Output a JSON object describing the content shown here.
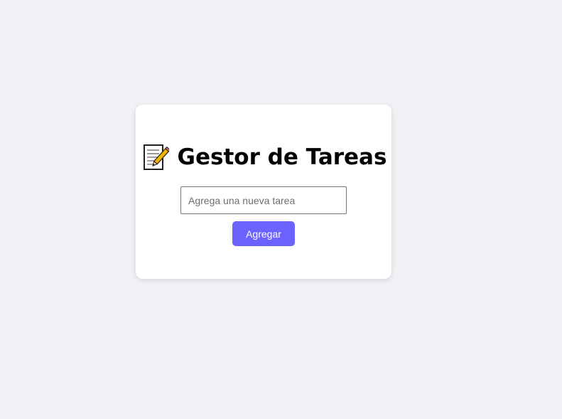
{
  "app": {
    "title_emoji_icon": "memo-icon",
    "title": "Gestor de Tareas"
  },
  "form": {
    "input_value": "",
    "input_placeholder": "Agrega una nueva tarea",
    "add_button_label": "Agregar"
  },
  "colors": {
    "page_background": "#f0f2f6",
    "card_background": "#ffffff",
    "accent_button": "#6c63ff",
    "button_text": "#ffffff"
  }
}
